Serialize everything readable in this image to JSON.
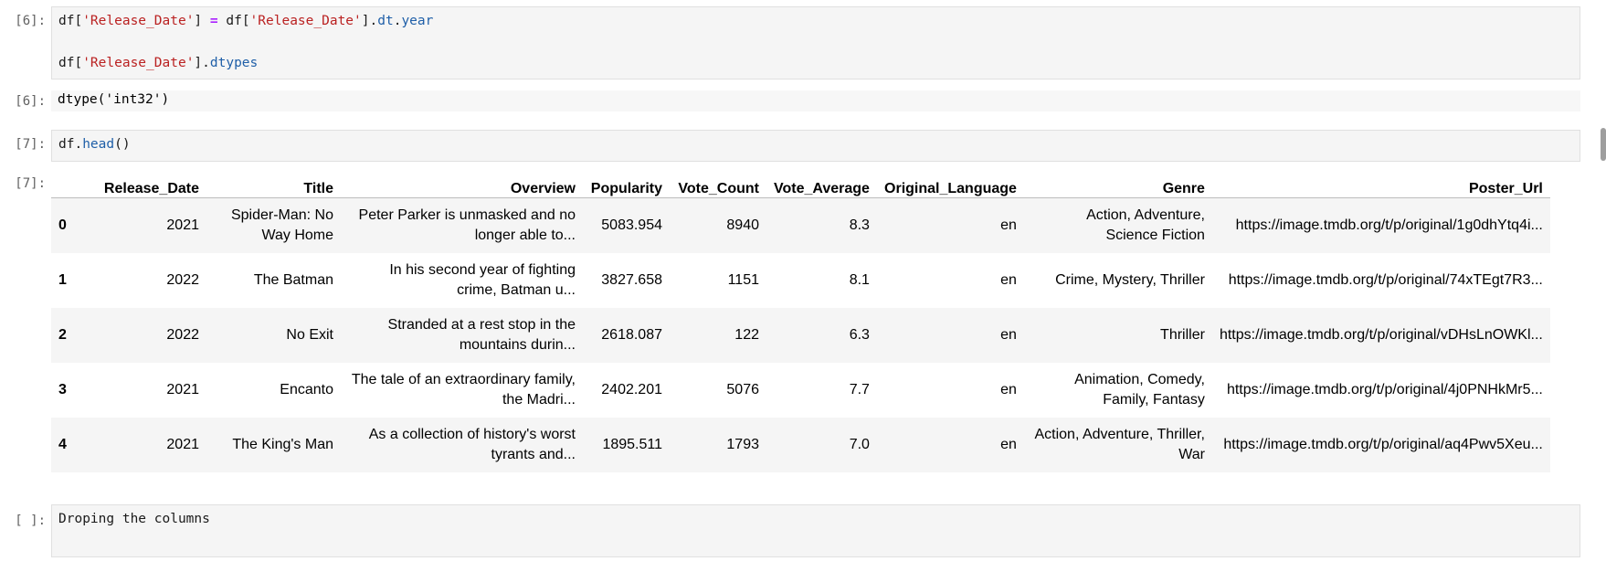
{
  "cells": {
    "c6_in_prompt": "[6]:",
    "c6_line1": {
      "a": "df[",
      "b": "'Release_Date'",
      "c": "] ",
      "d": "=",
      "e": " df[",
      "f": "'Release_Date'",
      "g": "].",
      "h": "dt",
      "i": ".",
      "j": "year"
    },
    "c6_line2": {
      "a": "df[",
      "b": "'Release_Date'",
      "c": "].",
      "d": "dtypes"
    },
    "c6_out_prompt": "[6]:",
    "c6_out": "dtype('int32')",
    "c7_in_prompt": "[7]:",
    "c7_code": {
      "a": "df.",
      "b": "head",
      "c": "()"
    },
    "c7_out_prompt": "[7]:",
    "c8_in_prompt": "[ ]:",
    "c8_code": "Droping the columns"
  },
  "table": {
    "columns": [
      "",
      "Release_Date",
      "Title",
      "Overview",
      "Popularity",
      "Vote_Count",
      "Vote_Average",
      "Original_Language",
      "Genre",
      "Poster_Url"
    ],
    "rows": [
      [
        "0",
        "2021",
        "Spider-Man: No Way Home",
        "Peter Parker is unmasked and no longer able to...",
        "5083.954",
        "8940",
        "8.3",
        "en",
        "Action, Adventure, Science Fiction",
        "https://image.tmdb.org/t/p/original/1g0dhYtq4i..."
      ],
      [
        "1",
        "2022",
        "The Batman",
        "In his second year of fighting crime, Batman u...",
        "3827.658",
        "1151",
        "8.1",
        "en",
        "Crime, Mystery, Thriller",
        "https://image.tmdb.org/t/p/original/74xTEgt7R3..."
      ],
      [
        "2",
        "2022",
        "No Exit",
        "Stranded at a rest stop in the mountains durin...",
        "2618.087",
        "122",
        "6.3",
        "en",
        "Thriller",
        "https://image.tmdb.org/t/p/original/vDHsLnOWKl..."
      ],
      [
        "3",
        "2021",
        "Encanto",
        "The tale of an extraordinary family, the Madri...",
        "2402.201",
        "5076",
        "7.7",
        "en",
        "Animation, Comedy, Family, Fantasy",
        "https://image.tmdb.org/t/p/original/4j0PNHkMr5..."
      ],
      [
        "4",
        "2021",
        "The King's Man",
        "As a collection of history's worst tyrants and...",
        "1895.511",
        "1793",
        "7.0",
        "en",
        "Action, Adventure, Thriller, War",
        "https://image.tmdb.org/t/p/original/aq4Pwv5Xeu..."
      ]
    ]
  }
}
